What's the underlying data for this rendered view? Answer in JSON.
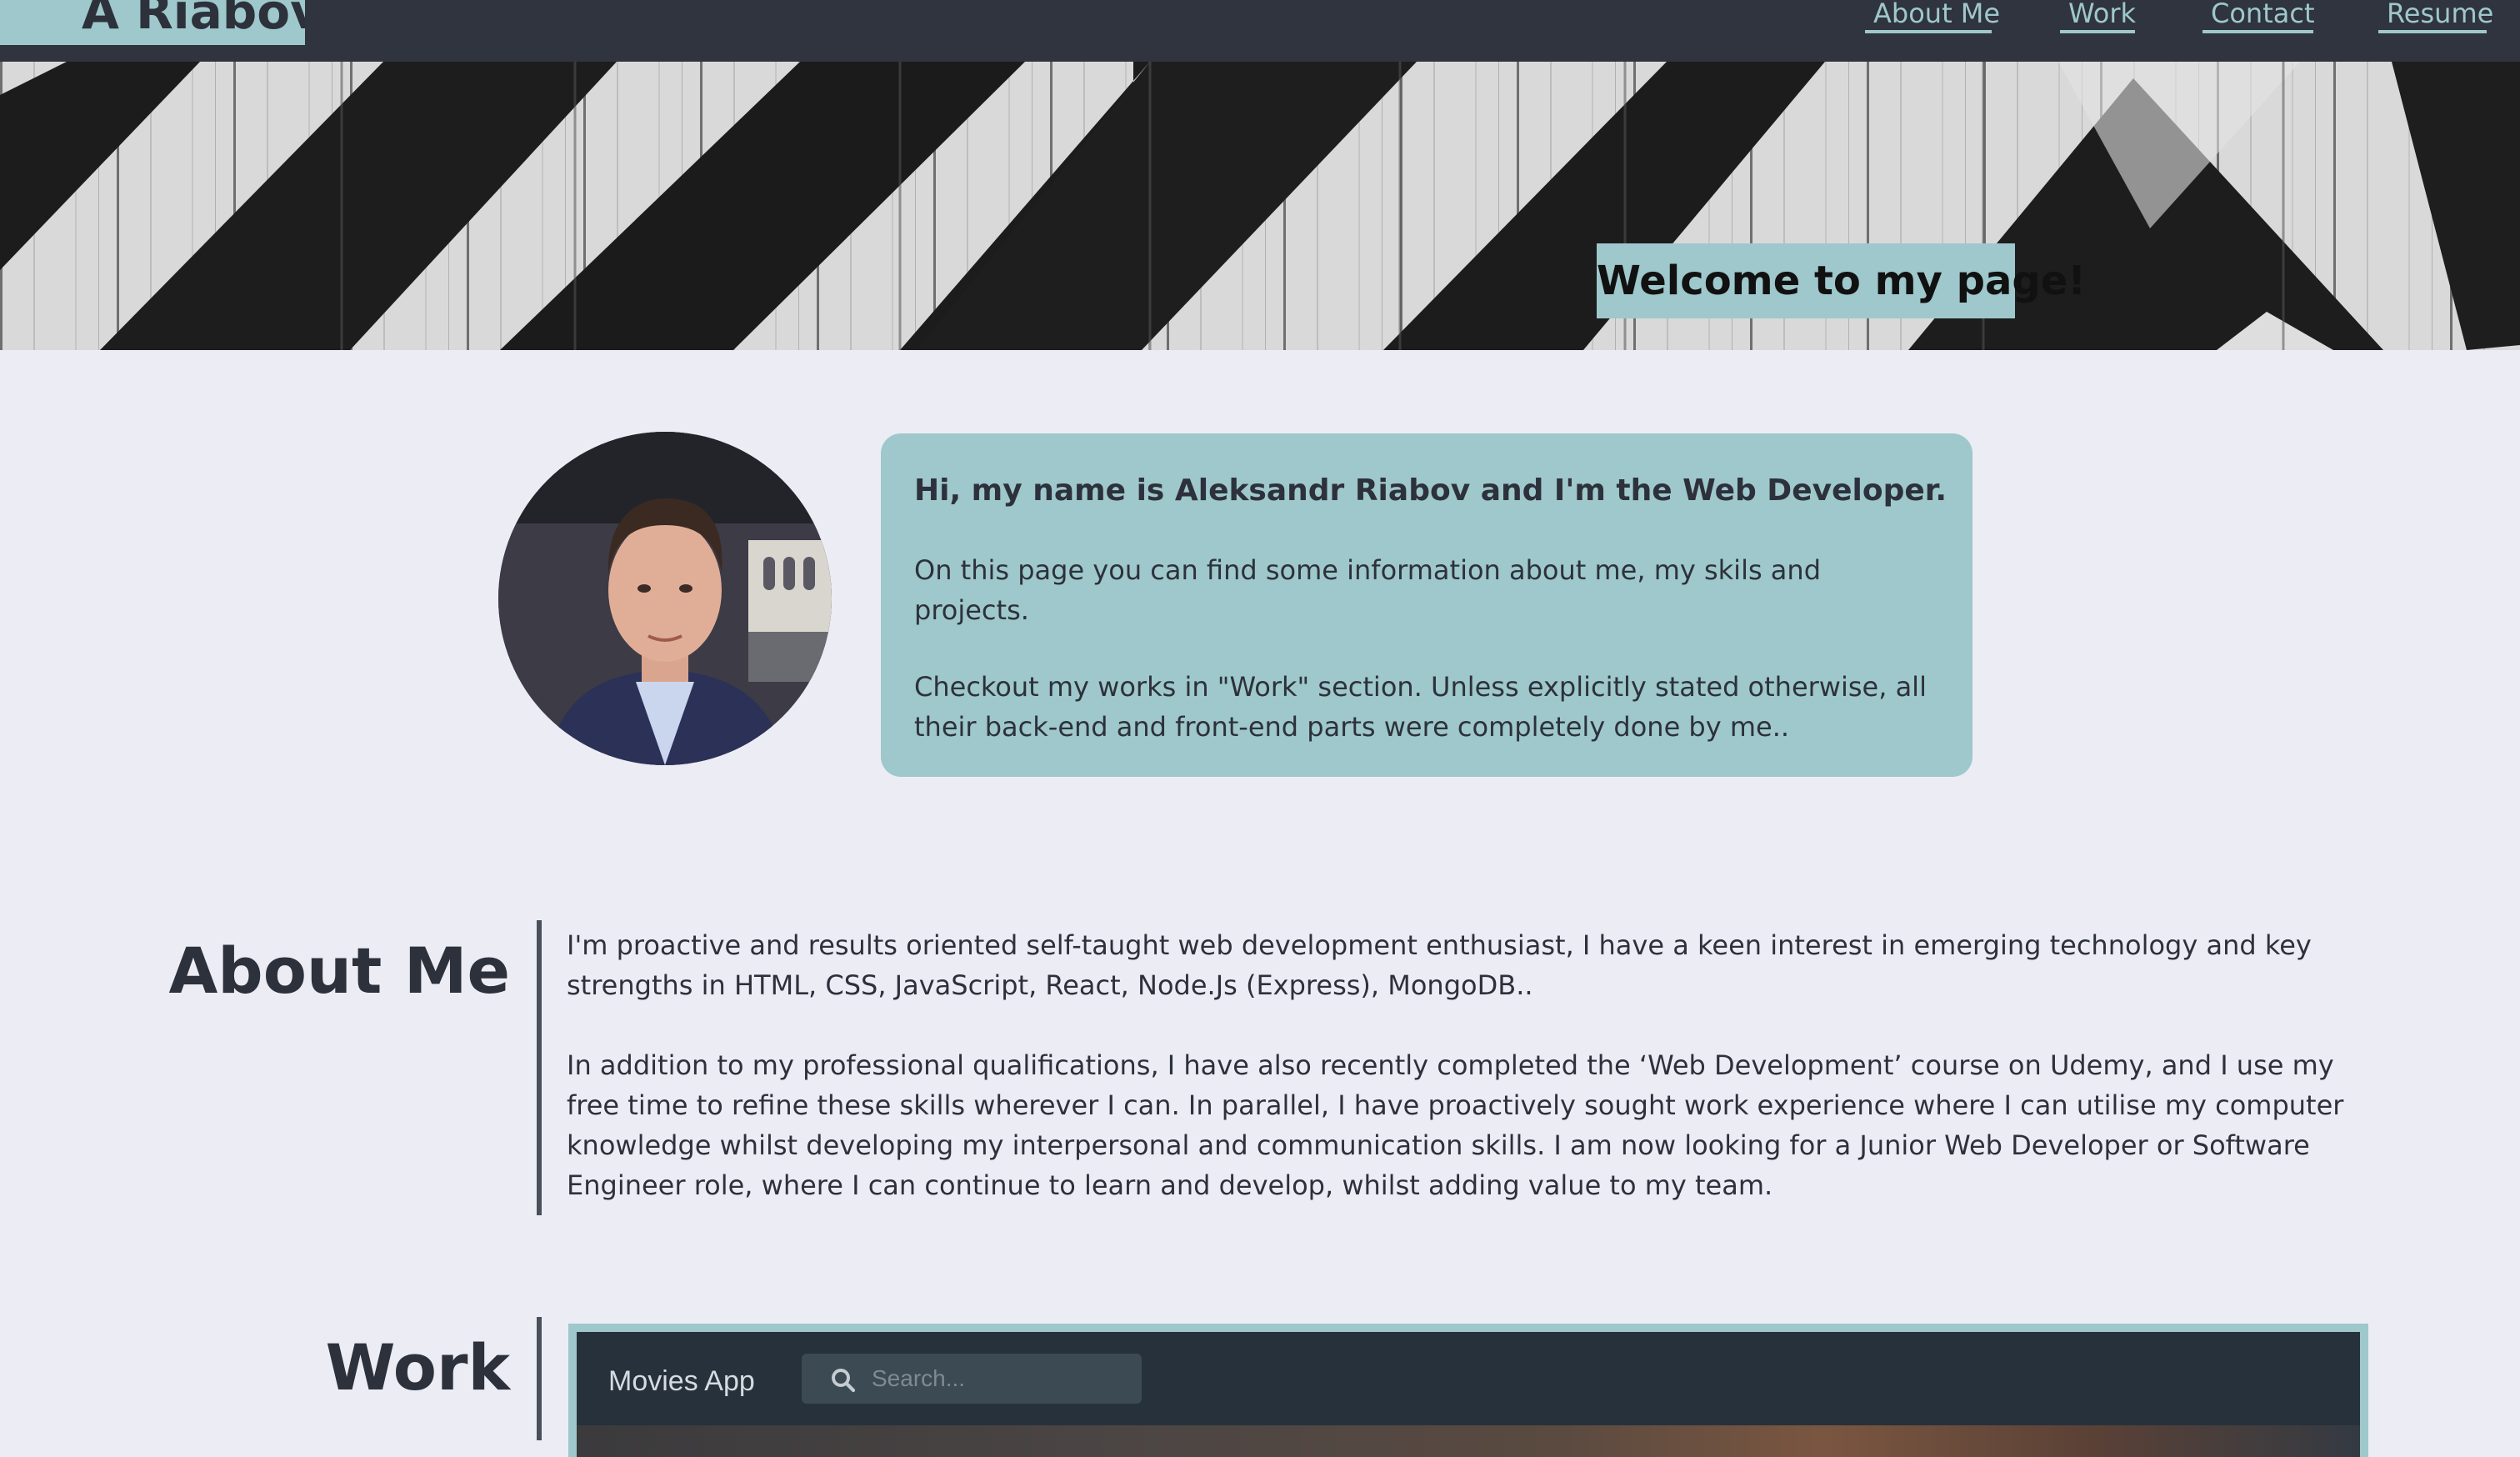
{
  "logo": {
    "text": "A Riabov"
  },
  "nav": {
    "links": [
      "About Me",
      "Work",
      "Contact",
      "Resume"
    ]
  },
  "hero": {
    "welcome": "Welcome to my page!"
  },
  "intro": {
    "title": "Hi, my name is Aleksandr Riabov and I'm the Web Developer.",
    "p1": "On this page you can find some information about me, my skils and projects.",
    "p2": "Checkout my works in \"Work\" section. Unless explicitly stated otherwise, all their back-end and front-end parts were completely done by me.."
  },
  "about": {
    "title": "About Me",
    "p1": "I'm proactive and results oriented self-taught web development enthusiast, I have a keen interest in emerging technology and key strengths in HTML, CSS, JavaScript, React, Node.Js (Express), MongoDB..",
    "p2": "In addition to my professional qualifications, I have also recently completed the ‘Web Development’ course on Udemy, and I use my free time to refine these skills wherever I can. In parallel, I have proactively sought work experience where I can utilise my computer knowledge whilst developing my interpersonal and communication skills. I am now looking for a Junior Web Developer or Software Engineer role, where I can continue to learn and develop, whilst adding value to my team."
  },
  "work": {
    "title": "Work",
    "preview": {
      "app_title": "Movies App",
      "search_placeholder": "Search..."
    }
  },
  "colors": {
    "accent": "#9ec8cb",
    "nav_bg": "#30343e",
    "page_bg": "#ececf4",
    "text": "#2d313b"
  },
  "icons": [
    "search-icon"
  ]
}
